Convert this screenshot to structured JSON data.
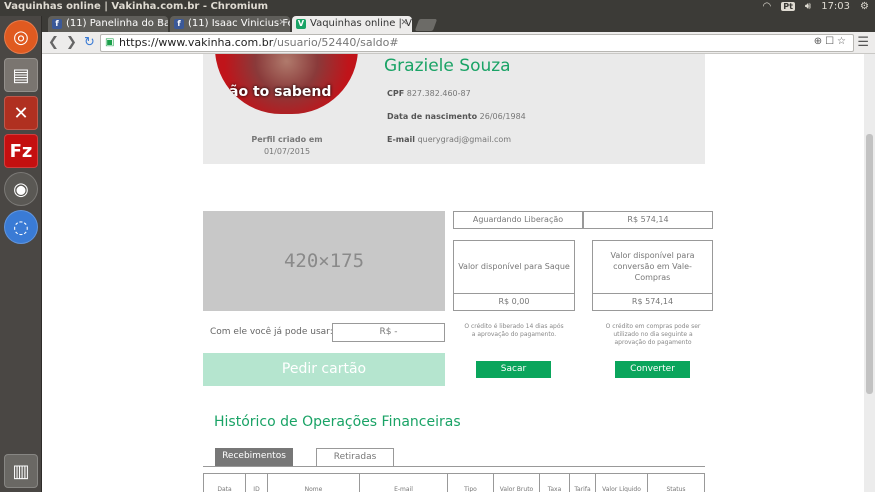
{
  "os": {
    "window_title": "Vaquinhas online | Vakinha.com.br - Chromium",
    "keyboard": "Pt",
    "time": "17:03"
  },
  "browser": {
    "tabs": [
      {
        "label": "(11) Panelinha do Ba"
      },
      {
        "label": "(11) Isaac Vinicius Fe"
      },
      {
        "label": "Vaquinhas online | V"
      }
    ],
    "url_host": "https://www.vakinha.com.br",
    "url_path": "/usuario/52440/saldo#"
  },
  "profile": {
    "name": "Graziele Souza",
    "avatar_text": "ão to sabend",
    "member_since_label": "Perfil criado em",
    "member_since_date": "01/07/2015",
    "cpf_label": "CPF",
    "cpf_value": "827.382.460-87",
    "birth_label": "Data de nascimento",
    "birth_value": "26/06/1984",
    "email_label": "E-mail",
    "email_value": "querygradj@gmail.com"
  },
  "card": {
    "placeholder": "420×175",
    "use_label": "Com ele você já pode usar:",
    "use_value": "R$ -",
    "request_button": "Pedir cartão"
  },
  "balance": {
    "pending_label": "Aguardando Liberação",
    "pending_value": "R$ 574,14",
    "withdraw_label": "Valor disponível para Saque",
    "withdraw_value": "R$ 0,00",
    "withdraw_note": "O crédito é liberado 14 dias após a aprovação do pagamento.",
    "withdraw_button": "Sacar",
    "convert_label": "Valor disponível para conversão em Vale-Compras",
    "convert_value": "R$ 574,14",
    "convert_note": "O crédito em compras pode ser utilizado no dia seguinte a aprovação do pagamento",
    "convert_button": "Converter"
  },
  "history": {
    "title": "Histórico de Operações Financeiras",
    "tabs": [
      "Recebimentos",
      "Retiradas"
    ],
    "columns": [
      "Data",
      "ID",
      "Nome",
      "E-mail",
      "Tipo",
      "Valor Bruto",
      "Taxa",
      "Tarifa",
      "Valor Líquido",
      "Status"
    ]
  }
}
